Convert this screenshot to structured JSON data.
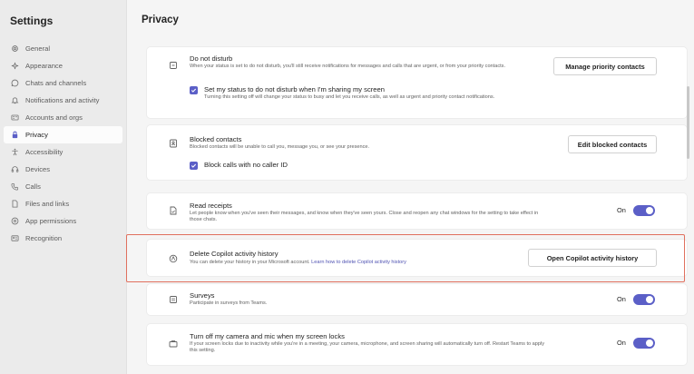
{
  "sidebar": {
    "title": "Settings",
    "items": [
      {
        "label": "General",
        "icon": "gear-icon"
      },
      {
        "label": "Appearance",
        "icon": "sparkle-icon"
      },
      {
        "label": "Chats and channels",
        "icon": "chat-icon"
      },
      {
        "label": "Notifications and activity",
        "icon": "bell-icon"
      },
      {
        "label": "Accounts and orgs",
        "icon": "id-card-icon"
      },
      {
        "label": "Privacy",
        "icon": "lock-icon",
        "active": true
      },
      {
        "label": "Accessibility",
        "icon": "accessibility-icon"
      },
      {
        "label": "Devices",
        "icon": "headset-icon"
      },
      {
        "label": "Calls",
        "icon": "phone-icon"
      },
      {
        "label": "Files and links",
        "icon": "document-icon"
      },
      {
        "label": "App permissions",
        "icon": "shield-icon"
      },
      {
        "label": "Recognition",
        "icon": "person-card-icon"
      }
    ]
  },
  "main": {
    "title": "Privacy",
    "dnd": {
      "title": "Do not disturb",
      "desc": "When your status is set to do not disturb, you'll still receive notifications for messages and calls that are urgent, or from your priority contacts.",
      "button": "Manage priority contacts",
      "checkbox_label": "Set my status to do not disturb when I'm sharing my screen",
      "checkbox_checked": true,
      "checkbox_desc": "Turning this setting off will change your status to busy and let you receive calls, as well as urgent and priority contact notifications."
    },
    "blocked": {
      "title": "Blocked contacts",
      "desc": "Blocked contacts will be unable to call you, message you, or see your presence.",
      "button": "Edit blocked contacts",
      "checkbox_label": "Block calls with no caller ID",
      "checkbox_checked": true
    },
    "receipts": {
      "title": "Read receipts",
      "desc": "Let people know when you've seen their messages, and know when they've seen yours. Close and reopen any chat windows for the setting to take effect in those chats.",
      "toggle_label": "On",
      "toggle_on": true
    },
    "copilot": {
      "title": "Delete Copilot activity history",
      "desc": "You can delete your history in your Microsoft account.",
      "link": "Learn how to delete Copilot activity history",
      "button": "Open Copilot activity history"
    },
    "surveys": {
      "title": "Surveys",
      "desc": "Participate in surveys from Teams.",
      "toggle_label": "On",
      "toggle_on": true
    },
    "camera": {
      "title": "Turn off my camera and mic when my screen locks",
      "desc": "If your screen locks due to inactivity while you're in a meeting, your camera, microphone, and screen sharing will automatically turn off. Restart Teams to apply this setting.",
      "toggle_label": "On",
      "toggle_on": true
    }
  },
  "colors": {
    "accent": "#5b5fc7",
    "highlight_border": "#e0705e",
    "link": "#4f52b2"
  }
}
